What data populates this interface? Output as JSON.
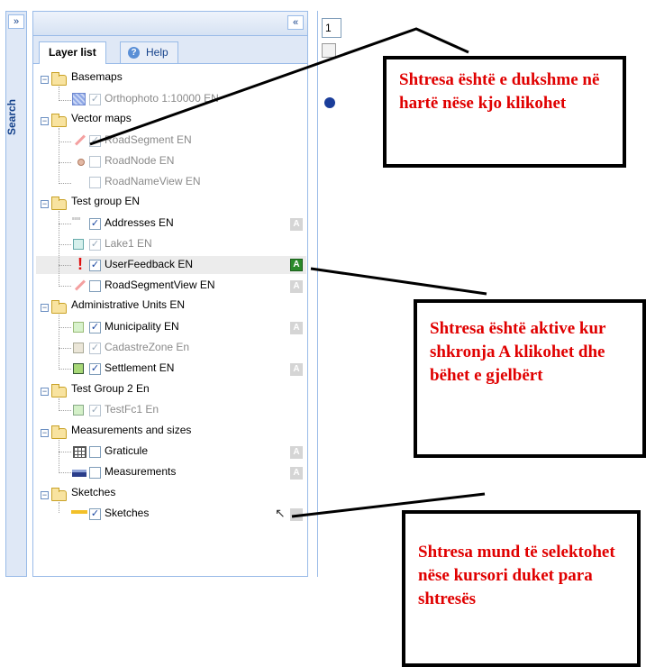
{
  "sidebar": {
    "label": "Search",
    "expand_icon": "double-chevron-right-icon",
    "expand_glyph": "»"
  },
  "panel": {
    "collapse_glyph": "«",
    "tabs": [
      {
        "label": "Layer list",
        "active": true
      },
      {
        "label": "Help",
        "active": false
      }
    ]
  },
  "tree": {
    "groups": [
      {
        "label": "Basemaps",
        "layers": [
          {
            "label": "Orthophoto 1:10000 EN",
            "checked": true,
            "enabled": false
          }
        ]
      },
      {
        "label": "Vector maps",
        "layers": [
          {
            "label": "RoadSegment EN",
            "checked": true,
            "enabled": false
          },
          {
            "label": "RoadNode EN",
            "checked": false,
            "enabled": false
          },
          {
            "label": "RoadNameView EN",
            "checked": false,
            "enabled": false
          }
        ]
      },
      {
        "label": "Test group EN",
        "layers": [
          {
            "label": "Addresses EN",
            "checked": true,
            "enabled": true,
            "a_button": "A",
            "active": false
          },
          {
            "label": "Lake1 EN",
            "checked": true,
            "enabled": false
          },
          {
            "label": "UserFeedback EN",
            "checked": true,
            "enabled": true,
            "a_button": "A",
            "active": true
          },
          {
            "label": "RoadSegmentView EN",
            "checked": false,
            "enabled": true,
            "a_button": "A",
            "active": false
          }
        ]
      },
      {
        "label": "Administrative Units EN",
        "layers": [
          {
            "label": "Municipality EN",
            "checked": true,
            "enabled": true,
            "a_button": "A",
            "active": false
          },
          {
            "label": "CadastreZone En",
            "checked": true,
            "enabled": false
          },
          {
            "label": "Settlement EN",
            "checked": true,
            "enabled": true,
            "a_button": "A",
            "active": false
          }
        ]
      },
      {
        "label": "Test Group 2 En",
        "layers": [
          {
            "label": "TestFc1 En",
            "checked": true,
            "enabled": false
          }
        ]
      },
      {
        "label": "Measurements and sizes",
        "layers": [
          {
            "label": "Graticule",
            "checked": false,
            "enabled": true,
            "a_button": "A",
            "active": false
          },
          {
            "label": "Measurements",
            "checked": false,
            "enabled": true,
            "a_button": "A",
            "active": false
          }
        ]
      },
      {
        "label": "Sketches",
        "layers": [
          {
            "label": "Sketches",
            "checked": true,
            "enabled": true
          }
        ]
      }
    ]
  },
  "map": {
    "tool_value": "1"
  },
  "annotations": {
    "callout_1": "Shtresa është e dukshme në hartë nëse kjo klikohet",
    "callout_2": "Shtresa është aktive kur shkronja A klikohet dhe bëhet e gjelbërt",
    "callout_3": "Shtresa mund të selektohet nëse kursori duket para shtresës"
  },
  "colors": {
    "active_green": "#2a8a2a",
    "annotation_red": "#e00000",
    "panel_border": "#99bbe8"
  }
}
